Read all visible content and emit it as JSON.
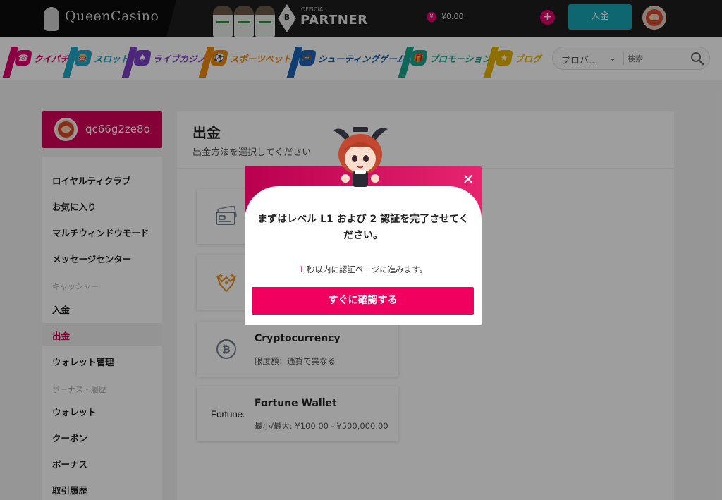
{
  "header": {
    "logo_text": "QueenCasino",
    "partner_small": "OFFICIAL",
    "partner_big": "PARTNER",
    "partner_badge_letter": "B",
    "balance": "¥0.00",
    "yen_symbol": "¥",
    "plus_symbol": "+",
    "deposit_label": "入金"
  },
  "nav": {
    "items": [
      {
        "label": "クイパチ",
        "color": "#e0006d",
        "icon": "pachinko-icon"
      },
      {
        "label": "スロット",
        "color": "#1fa7c9",
        "icon": "slot-icon"
      },
      {
        "label": "ライブカジノ",
        "color": "#7b3fc4",
        "icon": "live-casino-icon"
      },
      {
        "label": "スポーツベット",
        "color": "#f08a10",
        "icon": "sports-icon"
      },
      {
        "label": "シューティングゲーム",
        "color": "#1e63b5",
        "icon": "shooting-game-icon"
      },
      {
        "label": "プロモーション",
        "color": "#17a58e",
        "icon": "gift-icon"
      },
      {
        "label": "ブログ",
        "color": "#e7b400",
        "icon": "star-icon"
      }
    ],
    "provider_label": "プロバ...",
    "search_placeholder": "検索"
  },
  "user": {
    "username": "qc66g2ze8o"
  },
  "sidebar": {
    "items": [
      {
        "label": "ロイヤルティクラブ",
        "type": "item"
      },
      {
        "label": "お気に入り",
        "type": "item"
      },
      {
        "label": "マルチウィンドウモード",
        "type": "item"
      },
      {
        "label": "メッセージセンター",
        "type": "item"
      },
      {
        "label": "キャッシャー",
        "type": "heading"
      },
      {
        "label": "入金",
        "type": "item"
      },
      {
        "label": "出金",
        "type": "item",
        "active": true
      },
      {
        "label": "ウォレット管理",
        "type": "item"
      },
      {
        "label": "ボーナス・履歴",
        "type": "heading"
      },
      {
        "label": "ウォレット",
        "type": "item"
      },
      {
        "label": "クーポン",
        "type": "item"
      },
      {
        "label": "ボーナス",
        "type": "item"
      },
      {
        "label": "取引履歴",
        "type": "item"
      }
    ]
  },
  "main": {
    "title": "出金",
    "subtitle": "出金方法を選択してください",
    "methods": [
      {
        "name": "",
        "limit": "",
        "icon": "bank-card-icon"
      },
      {
        "name": "",
        "limit": "",
        "icon": "vip-wings-icon"
      },
      {
        "name": "Cryptocurrency",
        "limit": "限度額：通貨で異なる",
        "icon": "bitcoin-icon"
      },
      {
        "name": "Fortune Wallet",
        "limit": "最小/最大: ¥100.00 - ¥500,000.00",
        "icon": "fortune-logo",
        "logo_text": "Fortune."
      }
    ]
  },
  "modal": {
    "message": "まずはレベル L1 および 2 認証を完了させてください。",
    "countdown_number": "1",
    "countdown_text": " 秒以内に認証ページに進みます。",
    "button_label": "すぐに確認する",
    "close_symbol": "✕"
  },
  "colors": {
    "brand_pink": "#e0006d",
    "deposit_teal": "#18a7b5",
    "topbar": "#1d1d1d"
  }
}
